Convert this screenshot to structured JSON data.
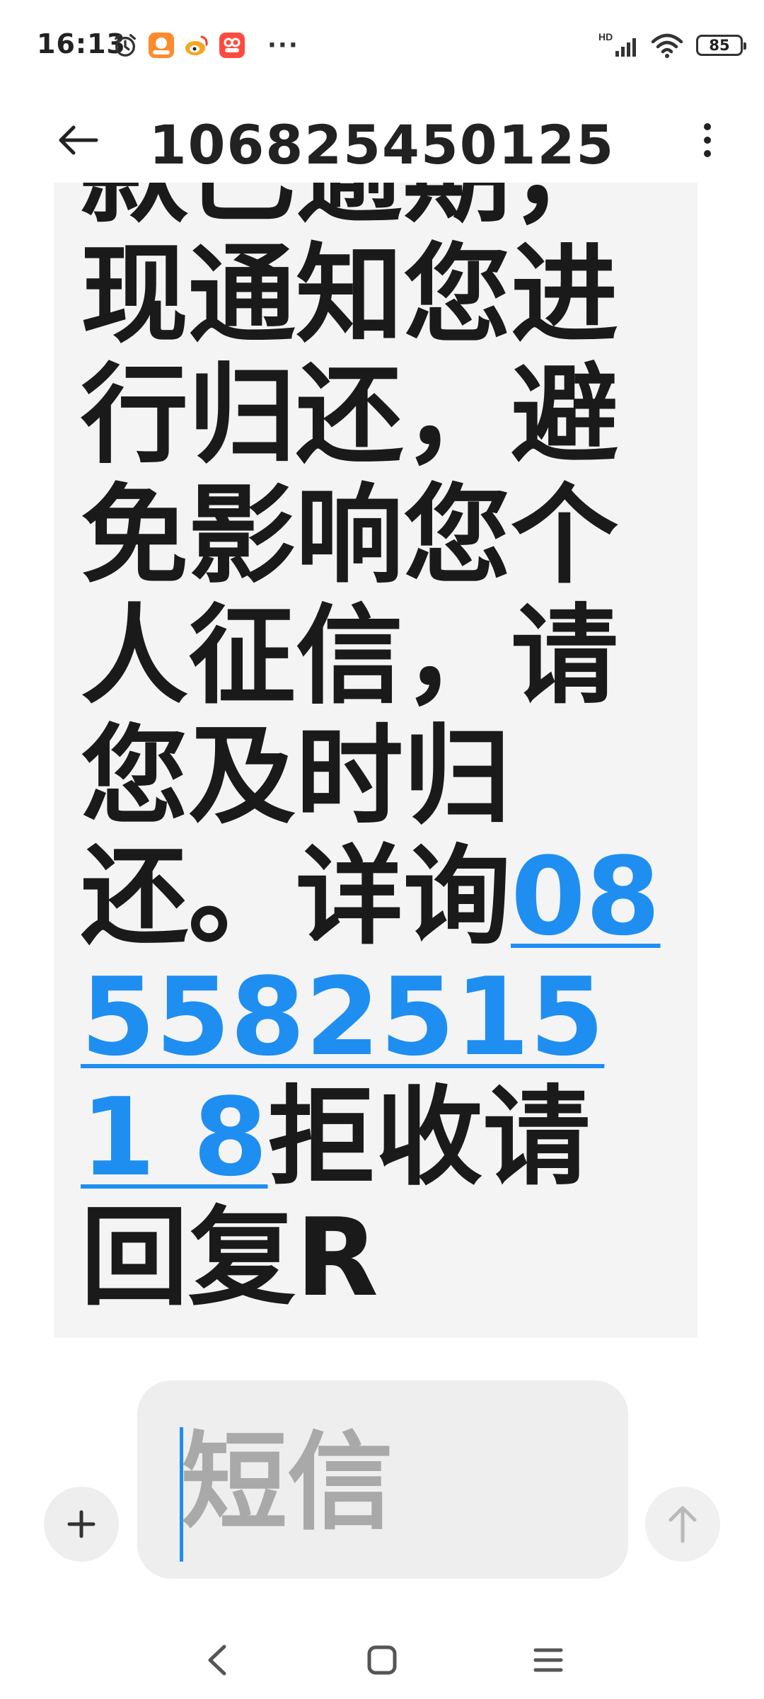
{
  "status_bar": {
    "time": "16:13",
    "network_label": "HD",
    "battery_level": "85",
    "more_indicator": "···",
    "icons": [
      "alarm-icon",
      "app-icon-orange",
      "weibo-icon",
      "app-icon-red",
      "signal-icon",
      "wifi-icon",
      "battery-icon"
    ]
  },
  "header": {
    "back_icon": "arrow-left-icon",
    "title": "106825450125",
    "menu_icon": "more-vert-icon"
  },
  "message": {
    "text_before_link": "款已逾期，现通知您进行归还，避免影响您个人征信，请您及时归还。详询",
    "phone_link": "0855825151 8",
    "text_after_link": "拒收请回复R"
  },
  "composer": {
    "attach_icon": "plus-icon",
    "placeholder": "短信",
    "send_icon": "arrow-up-icon"
  },
  "nav_bar": {
    "icons": [
      "back-chevron-icon",
      "home-square-icon",
      "recents-menu-icon"
    ]
  },
  "colors": {
    "link": "#1f8ef1",
    "bubble_bg": "#f4f4f4",
    "input_bg": "#eeeeee",
    "text": "#1a1a1a"
  }
}
